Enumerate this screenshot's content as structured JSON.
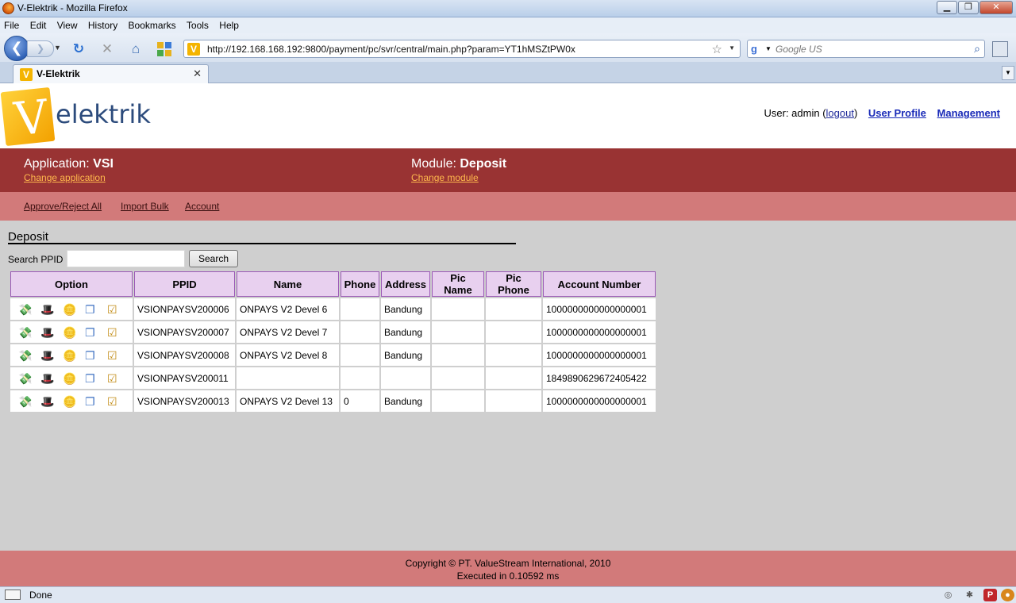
{
  "browser": {
    "window_title": "V-Elektrik - Mozilla Firefox",
    "menu": [
      "File",
      "Edit",
      "View",
      "History",
      "Bookmarks",
      "Tools",
      "Help"
    ],
    "url": "http://192.168.168.192:9800/payment/pc/svr/central/main.php?param=YT1hMSZtPW0x",
    "search_placeholder": "Google US",
    "tab_title": "V-Elektrik",
    "status": "Done"
  },
  "header": {
    "logo_letter": "V",
    "logo_text": "elektrik",
    "user_label": "User: admin (",
    "logout": "logout",
    "user_label_end": ")",
    "user_profile": "User Profile",
    "management": "Management"
  },
  "appbar": {
    "application_label": "Application:",
    "application_value": "VSI",
    "change_application": "Change application",
    "module_label": "Module:",
    "module_value": "Deposit",
    "change_module": "Change module"
  },
  "submenu": [
    "Approve/Reject All",
    "Import Bulk",
    "Account"
  ],
  "section": {
    "title": "Deposit",
    "search_label": "Search PPID",
    "search_value": "",
    "search_button": "Search"
  },
  "table": {
    "headers": [
      "Option",
      "PPID",
      "Name",
      "Phone",
      "Address",
      "Pic Name",
      "Pic Phone",
      "Account Number"
    ],
    "option_icons": [
      "money-icon",
      "wizard-hat-icon",
      "coins-icon",
      "copy-icon",
      "checkbox-icon"
    ],
    "rows": [
      {
        "ppid": "VSIONPAYSV200006",
        "name": "ONPAYS V2 Devel 6",
        "phone": "",
        "address": "Bandung",
        "pic_name": "",
        "pic_phone": "",
        "account": "1000000000000000001"
      },
      {
        "ppid": "VSIONPAYSV200007",
        "name": "ONPAYS V2 Devel 7",
        "phone": "",
        "address": "Bandung",
        "pic_name": "",
        "pic_phone": "",
        "account": "1000000000000000001"
      },
      {
        "ppid": "VSIONPAYSV200008",
        "name": "ONPAYS V2 Devel 8",
        "phone": "",
        "address": "Bandung",
        "pic_name": "",
        "pic_phone": "",
        "account": "1000000000000000001"
      },
      {
        "ppid": "VSIONPAYSV200011",
        "name": "",
        "phone": "",
        "address": "",
        "pic_name": "",
        "pic_phone": "",
        "account": "1849890629672405422"
      },
      {
        "ppid": "VSIONPAYSV200013",
        "name": "ONPAYS V2 Devel 13",
        "phone": "0",
        "address": "Bandung",
        "pic_name": "",
        "pic_phone": "",
        "account": "1000000000000000001"
      }
    ]
  },
  "footer": {
    "copyright": "Copyright © PT. ValueStream International, 2010",
    "executed": "Executed in 0.10592 ms"
  },
  "colors": {
    "appbar": "#993333",
    "submenu": "#d27a7a",
    "header_cell": "#e8d0ef",
    "link_orange": "#ffb84d"
  }
}
